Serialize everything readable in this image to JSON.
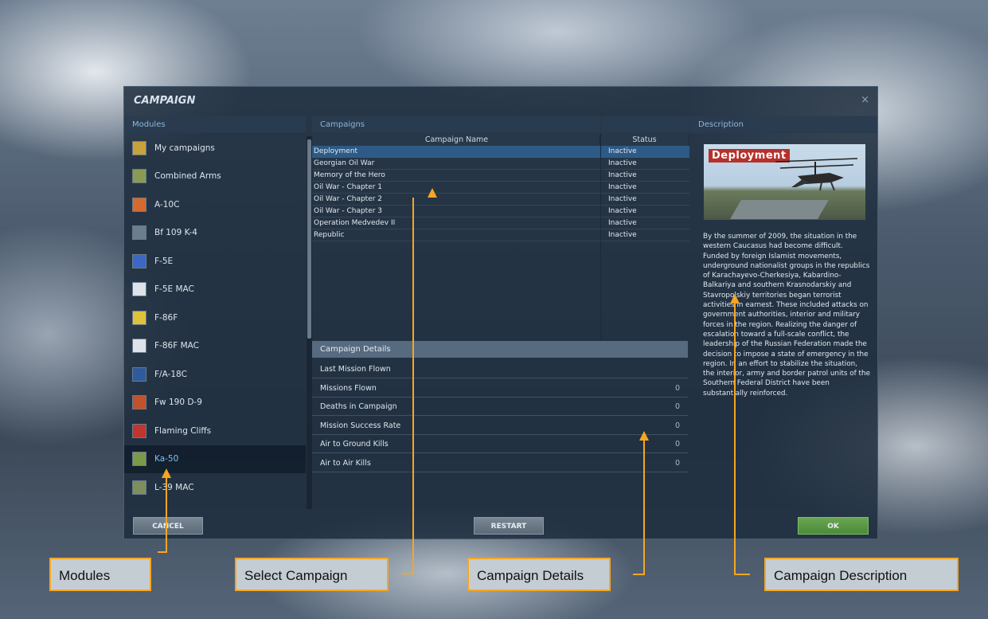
{
  "dialog": {
    "title": "CAMPAIGN",
    "close": "×",
    "headers": {
      "modules": "Modules",
      "campaigns": "Campaigns",
      "description": "Description"
    }
  },
  "modules": [
    {
      "label": "My campaigns",
      "icon": "folder-icon",
      "color": "#c8a23a"
    },
    {
      "label": "Combined Arms",
      "icon": "combined-arms-icon",
      "color": "#8a9a52"
    },
    {
      "label": "A-10C",
      "icon": "a10c-icon",
      "color": "#d46a2e"
    },
    {
      "label": "Bf 109 K-4",
      "icon": "bf109-icon",
      "color": "#6a7e8e"
    },
    {
      "label": "F-5E",
      "icon": "f5e-icon",
      "color": "#3a68c4"
    },
    {
      "label": "F-5E MAC",
      "icon": "mac-icon",
      "color": "#dde3e8"
    },
    {
      "label": "F-86F",
      "icon": "f86-icon",
      "color": "#e0c23a"
    },
    {
      "label": "F-86F MAC",
      "icon": "mac-icon",
      "color": "#dde3e8"
    },
    {
      "label": "F/A-18C",
      "icon": "fa18-icon",
      "color": "#2f5a9c"
    },
    {
      "label": "Fw 190 D-9",
      "icon": "fw190-icon",
      "color": "#c0522e"
    },
    {
      "label": "Flaming Cliffs",
      "icon": "flaming-cliffs-icon",
      "color": "#c0352e"
    },
    {
      "label": "Ka-50",
      "icon": "ka50-icon",
      "color": "#7a9a4a",
      "selected": true
    },
    {
      "label": "L-39 MAC",
      "icon": "l39-icon",
      "color": "#7e8e5c"
    }
  ],
  "campaigns": {
    "columns": [
      "Campaign Name",
      "Status"
    ],
    "rows": [
      {
        "name": "Deployment",
        "status": "Inactive",
        "selected": true
      },
      {
        "name": "Georgian Oil War",
        "status": "Inactive"
      },
      {
        "name": "Memory of the Hero",
        "status": "Inactive"
      },
      {
        "name": "Oil War - Chapter 1",
        "status": "Inactive"
      },
      {
        "name": "Oil War - Chapter 2",
        "status": "Inactive"
      },
      {
        "name": "Oil War - Chapter 3",
        "status": "Inactive"
      },
      {
        "name": "Operation Medvedev II",
        "status": "Inactive"
      },
      {
        "name": "Republic",
        "status": "Inactive"
      }
    ]
  },
  "details": {
    "title": "Campaign Details",
    "rows": [
      {
        "label": "Last Mission Flown",
        "value": ""
      },
      {
        "label": "Missions Flown",
        "value": "0"
      },
      {
        "label": "Deaths in Campaign",
        "value": "0"
      },
      {
        "label": "Mission Success Rate",
        "value": "0"
      },
      {
        "label": "Air to Ground Kills",
        "value": "0"
      },
      {
        "label": "Air to Air Kills",
        "value": "0"
      }
    ]
  },
  "description": {
    "image_caption": "Deployment",
    "text": "By the summer of 2009, the situation in the western Caucasus had become difficult. Funded by foreign Islamist movements, underground nationalist groups in the republics of Karachayevo-Cherkesiya, Kabardino-Balkariya and southern Krasnodarskiy and Stavropolskiy territories began terrorist activities in earnest. These included attacks on government authorities, interior and military forces in the region. Realizing the danger of escalation toward a full-scale conflict, the leadership of the Russian Federation made the decision to impose a state of emergency in the region. In an effort to stabilize the situation, the interior, army and border patrol units of the Southern Federal District have been substantially reinforced."
  },
  "buttons": {
    "cancel": "CANCEL",
    "restart": "RESTART",
    "ok": "OK"
  },
  "callouts": {
    "modules": "Modules",
    "select_campaign": "Select Campaign",
    "campaign_details": "Campaign Details",
    "campaign_description": "Campaign Description"
  }
}
